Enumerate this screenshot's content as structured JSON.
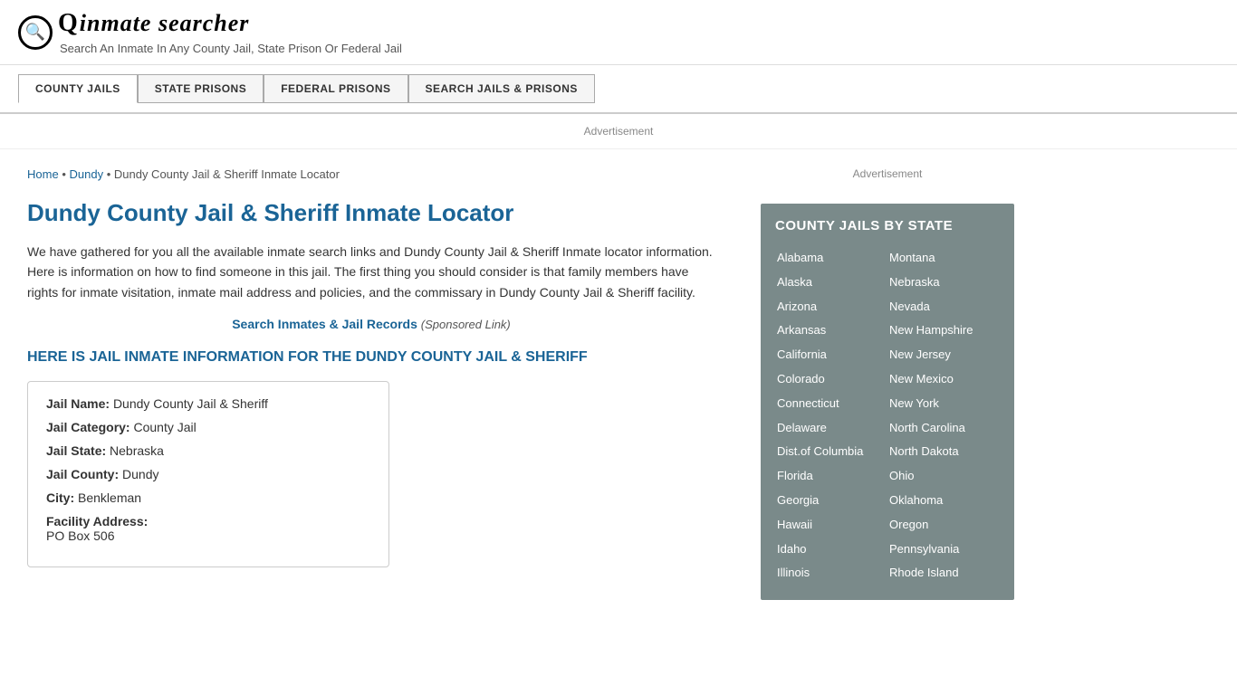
{
  "header": {
    "logo_icon": "🔍",
    "logo_text": "inmate searcher",
    "tagline": "Search An Inmate In Any County Jail, State Prison Or Federal Jail"
  },
  "nav": {
    "buttons": [
      {
        "label": "COUNTY JAILS",
        "active": true
      },
      {
        "label": "STATE PRISONS",
        "active": false
      },
      {
        "label": "FEDERAL PRISONS",
        "active": false
      },
      {
        "label": "SEARCH JAILS & PRISONS",
        "active": false
      }
    ]
  },
  "ad": {
    "label": "Advertisement"
  },
  "breadcrumb": {
    "home": "Home",
    "dundy": "Dundy",
    "current": "Dundy County Jail & Sheriff Inmate Locator"
  },
  "page": {
    "title": "Dundy County Jail & Sheriff Inmate Locator",
    "description": "We have gathered for you all the available inmate search links and Dundy County Jail & Sheriff Inmate locator information. Here is information on how to find someone in this jail. The first thing you should consider is that family members have rights for inmate visitation, inmate mail address and policies, and the commissary in Dundy County Jail & Sheriff facility.",
    "sponsored_link_text": "Search Inmates & Jail Records",
    "sponsored_note": "(Sponsored Link)",
    "section_heading": "HERE IS JAIL INMATE INFORMATION FOR THE DUNDY COUNTY JAIL & SHERIFF"
  },
  "info_box": {
    "jail_name_label": "Jail Name:",
    "jail_name_value": "Dundy County Jail & Sheriff",
    "jail_category_label": "Jail Category:",
    "jail_category_value": "County Jail",
    "jail_state_label": "Jail State:",
    "jail_state_value": "Nebraska",
    "jail_county_label": "Jail County:",
    "jail_county_value": "Dundy",
    "city_label": "City:",
    "city_value": "Benkleman",
    "facility_address_label": "Facility Address:",
    "facility_address_value": "PO Box 506"
  },
  "sidebar": {
    "ad_label": "Advertisement",
    "county_jails_title": "COUNTY JAILS BY STATE",
    "states_left": [
      "Alabama",
      "Alaska",
      "Arizona",
      "Arkansas",
      "California",
      "Colorado",
      "Connecticut",
      "Delaware",
      "Dist.of Columbia",
      "Florida",
      "Georgia",
      "Hawaii",
      "Idaho",
      "Illinois"
    ],
    "states_right": [
      "Montana",
      "Nebraska",
      "Nevada",
      "New Hampshire",
      "New Jersey",
      "New Mexico",
      "New York",
      "North Carolina",
      "North Dakota",
      "Ohio",
      "Oklahoma",
      "Oregon",
      "Pennsylvania",
      "Rhode Island"
    ]
  }
}
